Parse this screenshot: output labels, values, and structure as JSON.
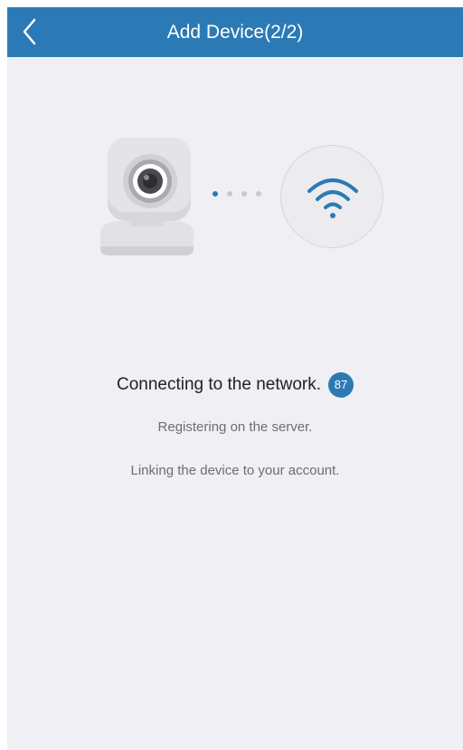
{
  "header": {
    "title": "Add Device(2/2)",
    "back_icon": "chevron-left-icon"
  },
  "illustration": {
    "camera_icon": "camera-icon",
    "wifi_icon": "wifi-icon",
    "progress_dots": 4,
    "active_dot": 1
  },
  "status": {
    "main": "Connecting to the network.",
    "progress": "87",
    "step2": "Registering on the server.",
    "step3": "Linking the device to your account."
  },
  "colors": {
    "accent": "#2b7ab5",
    "background": "#efeff4",
    "header_text": "#ffffff"
  }
}
